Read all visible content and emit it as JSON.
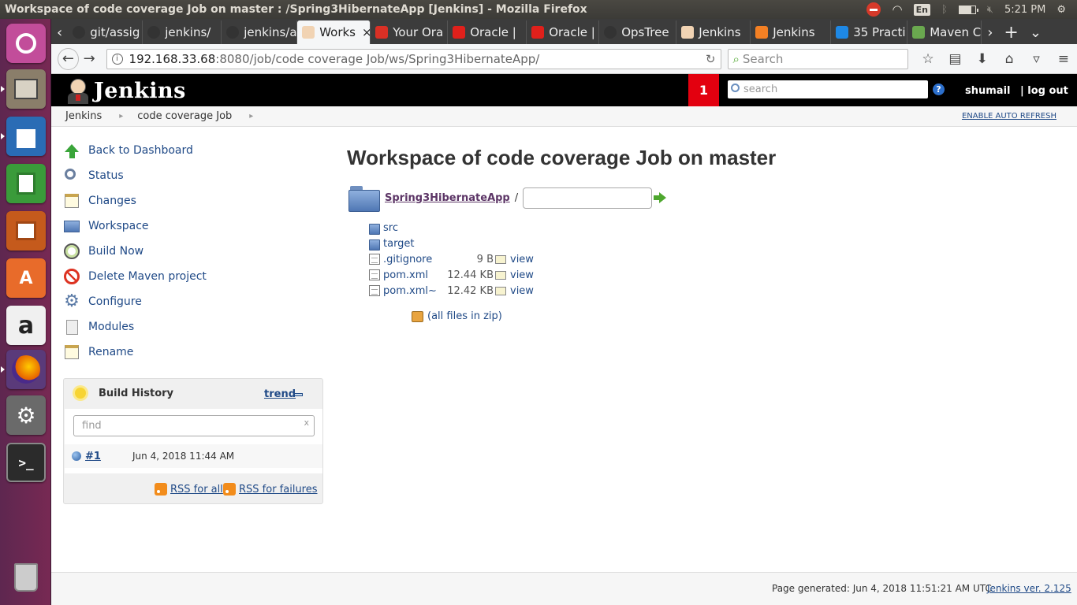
{
  "os": {
    "window_title": "Workspace of code coverage Job on master : /Spring3HibernateApp [Jenkins] - Mozilla Firefox",
    "keyboard_layout": "En",
    "clock": "5:21 PM",
    "launcher": [
      {
        "name": "ubuntu-logo-icon",
        "label": ""
      },
      {
        "name": "files-icon",
        "label": ""
      },
      {
        "name": "writer-icon",
        "label": ""
      },
      {
        "name": "calc-icon",
        "label": ""
      },
      {
        "name": "impress-icon",
        "label": ""
      },
      {
        "name": "software-center-icon",
        "label": ""
      },
      {
        "name": "amazon-icon",
        "label": "a"
      },
      {
        "name": "firefox-icon",
        "label": ""
      },
      {
        "name": "settings-icon",
        "label": ""
      },
      {
        "name": "terminal-icon",
        "label": ">_"
      },
      {
        "name": "trash-icon",
        "label": ""
      }
    ]
  },
  "browser": {
    "tabs": [
      {
        "label": "git/assig",
        "icon": "github-icon",
        "color": "#333333"
      },
      {
        "label": "jenkins/",
        "icon": "github-icon",
        "color": "#333333"
      },
      {
        "label": "jenkins/a",
        "icon": "github-icon",
        "color": "#333333"
      },
      {
        "label": "Works",
        "icon": "jenkins-icon",
        "color": "#f1d3b3",
        "active": true
      },
      {
        "label": "Your Ora",
        "icon": "gmail-icon",
        "color": "#d93025"
      },
      {
        "label": "Oracle | ",
        "icon": "oracle-icon",
        "color": "#e0201b"
      },
      {
        "label": "Oracle | ",
        "icon": "oracle-icon",
        "color": "#e0201b"
      },
      {
        "label": "OpsTree",
        "icon": "github-icon",
        "color": "#333333"
      },
      {
        "label": "Jenkins",
        "icon": "jenkins-icon",
        "color": "#f1d3b3"
      },
      {
        "label": "Jenkins",
        "icon": "stackoverflow-icon",
        "color": "#f48024"
      },
      {
        "label": "35 Practi",
        "icon": "blog-icon",
        "color": "#1e88e5"
      },
      {
        "label": "Maven C",
        "icon": "maven-icon",
        "color": "#6aa84f"
      }
    ],
    "url_host": "192.168.33.68",
    "url_path": ":8080/job/code coverage Job/ws/Spring3HibernateApp/",
    "search_placeholder": "Search"
  },
  "jenkins": {
    "title": "Jenkins",
    "notifications": "1",
    "search_placeholder": "search",
    "help": "?",
    "user": "shumail",
    "logout": "| log out",
    "breadcrumb": [
      "Jenkins",
      "code coverage Job"
    ],
    "auto_refresh": "ENABLE AUTO REFRESH",
    "tasks": [
      {
        "label": "Back to Dashboard",
        "icon": "up-arrow-icon"
      },
      {
        "label": "Status",
        "icon": "search-icon"
      },
      {
        "label": "Changes",
        "icon": "notepad-icon"
      },
      {
        "label": "Workspace",
        "icon": "folder-icon"
      },
      {
        "label": "Build Now",
        "icon": "clock-icon"
      },
      {
        "label": "Delete Maven project",
        "icon": "no-entry-icon"
      },
      {
        "label": "Configure",
        "icon": "gear-icon"
      },
      {
        "label": "Modules",
        "icon": "document-icon"
      },
      {
        "label": "Rename",
        "icon": "notepad-icon"
      }
    ],
    "build_history": {
      "title": "Build History",
      "trend": "trend",
      "find_placeholder": "find",
      "clear": "x",
      "builds": [
        {
          "number": "#1",
          "date": "Jun 4, 2018 11:44 AM"
        }
      ],
      "rss_all": "RSS for all",
      "rss_failures": "RSS for failures"
    },
    "page_title": "Workspace of code coverage Job on master",
    "dir_name": "Spring3HibernateApp",
    "dir_sep": "/",
    "entries": [
      {
        "name": "src",
        "type": "folder",
        "size": "",
        "view": ""
      },
      {
        "name": "target",
        "type": "folder",
        "size": "",
        "view": ""
      },
      {
        "name": ".gitignore",
        "type": "file",
        "size": "9 B",
        "view": "view"
      },
      {
        "name": "pom.xml",
        "type": "file",
        "size": "12.44 KB",
        "view": "view"
      },
      {
        "name": "pom.xml~",
        "type": "file",
        "size": "12.42 KB",
        "view": "view"
      }
    ],
    "zip": "(all files in zip)",
    "footer_generated": "Page generated: Jun 4, 2018 11:51:21 AM UTC",
    "footer_version": "Jenkins ver. 2.125"
  }
}
